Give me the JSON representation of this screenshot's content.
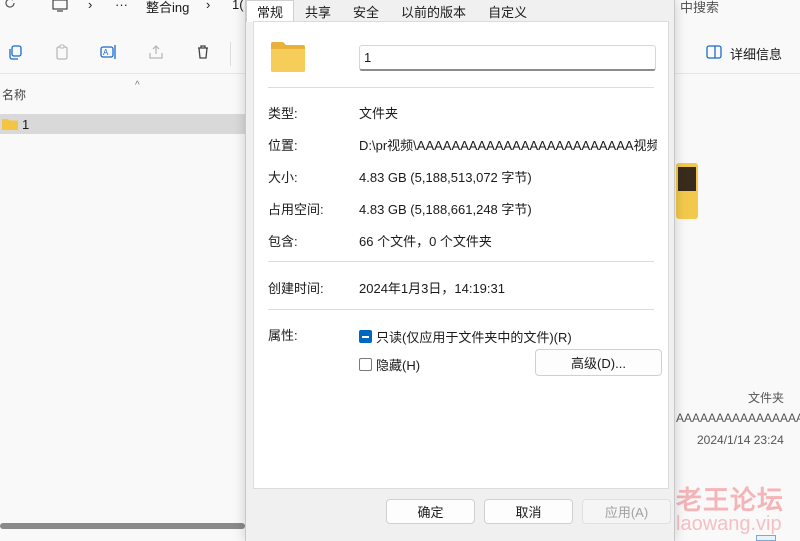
{
  "explorer": {
    "address": {
      "refresh_icon": "refresh-icon",
      "chevron1": "›",
      "ellipsis": "···",
      "folder": "整合ing",
      "chevron2": "›",
      "trunc": "1("
    },
    "search_hint": "中搜索",
    "toolbar": {
      "details_label": "详细信息"
    },
    "column_name": "名称",
    "files": [
      {
        "name": "1"
      }
    ],
    "details": {
      "type": "文件夹",
      "path": "AAAAAAAAAAAAAAAA...",
      "date": "2024/1/14 23:24"
    },
    "watermark": {
      "line1": "老王论坛",
      "line2": "laowang.vip"
    }
  },
  "dialog": {
    "tabs": [
      "常规",
      "共享",
      "安全",
      "以前的版本",
      "自定义"
    ],
    "active_tab": "常规",
    "name_value": "1",
    "rows": {
      "type_label": "类型:",
      "type_value": "文件夹",
      "location_label": "位置:",
      "location_value": "D:\\pr视频\\AAAAAAAAAAAAAAAAAAAAAAAAA视频\\整合",
      "size_label": "大小:",
      "size_value": "4.83 GB (5,188,513,072 字节)",
      "disk_label": "占用空间:",
      "disk_value": "4.83 GB (5,188,661,248 字节)",
      "contains_label": "包含:",
      "contains_value": "66 个文件，0 个文件夹",
      "created_label": "创建时间:",
      "created_value": "2024年1月3日，14:19:31",
      "attr_label": "属性:"
    },
    "readonly_label": "只读(仅应用于文件夹中的文件)(R)",
    "readonly_state": "indeterminate",
    "hidden_label": "隐藏(H)",
    "hidden_state": "unchecked",
    "advanced_label": "高级(D)...",
    "ok_label": "确定",
    "cancel_label": "取消",
    "apply_label": "应用(A)"
  },
  "colors": {
    "accent": "#0067c0",
    "folder_yellow": "#f4c542",
    "watermark": "#f4b4b8"
  }
}
